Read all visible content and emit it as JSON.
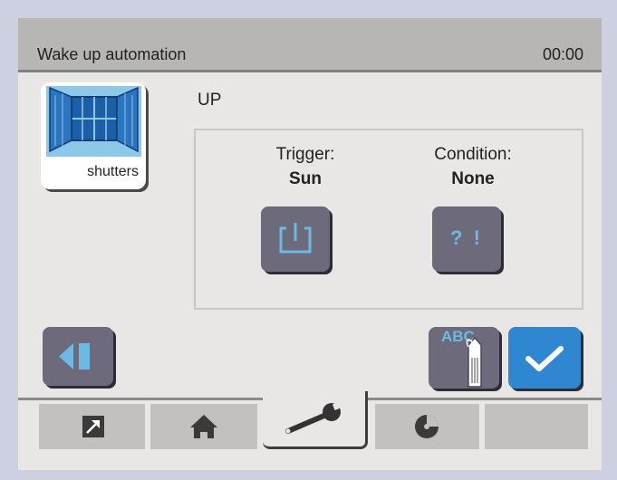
{
  "header": {
    "title": "Wake up automation",
    "time": "00:00"
  },
  "device": {
    "label": "shutters",
    "icon": "shutters-icon"
  },
  "direction": "UP",
  "trigger": {
    "heading": "Trigger:",
    "value": "Sun",
    "icon": "power-icon"
  },
  "condition": {
    "heading": "Condition:",
    "value": "None",
    "button_text": "? !"
  },
  "actions": {
    "rename_text": "ABC",
    "back_icon": "back-icon",
    "confirm_icon": "checkmark-icon"
  },
  "tabs": [
    {
      "icon": "arrow-out-icon"
    },
    {
      "icon": "home-icon"
    },
    {
      "icon": "wrench-icon",
      "active": true
    },
    {
      "icon": "disc-icon"
    },
    {
      "icon": "empty"
    }
  ],
  "colors": {
    "accent": "#2f86d1",
    "button": "#6d6a7b",
    "icon_blue": "#6db9e6"
  }
}
